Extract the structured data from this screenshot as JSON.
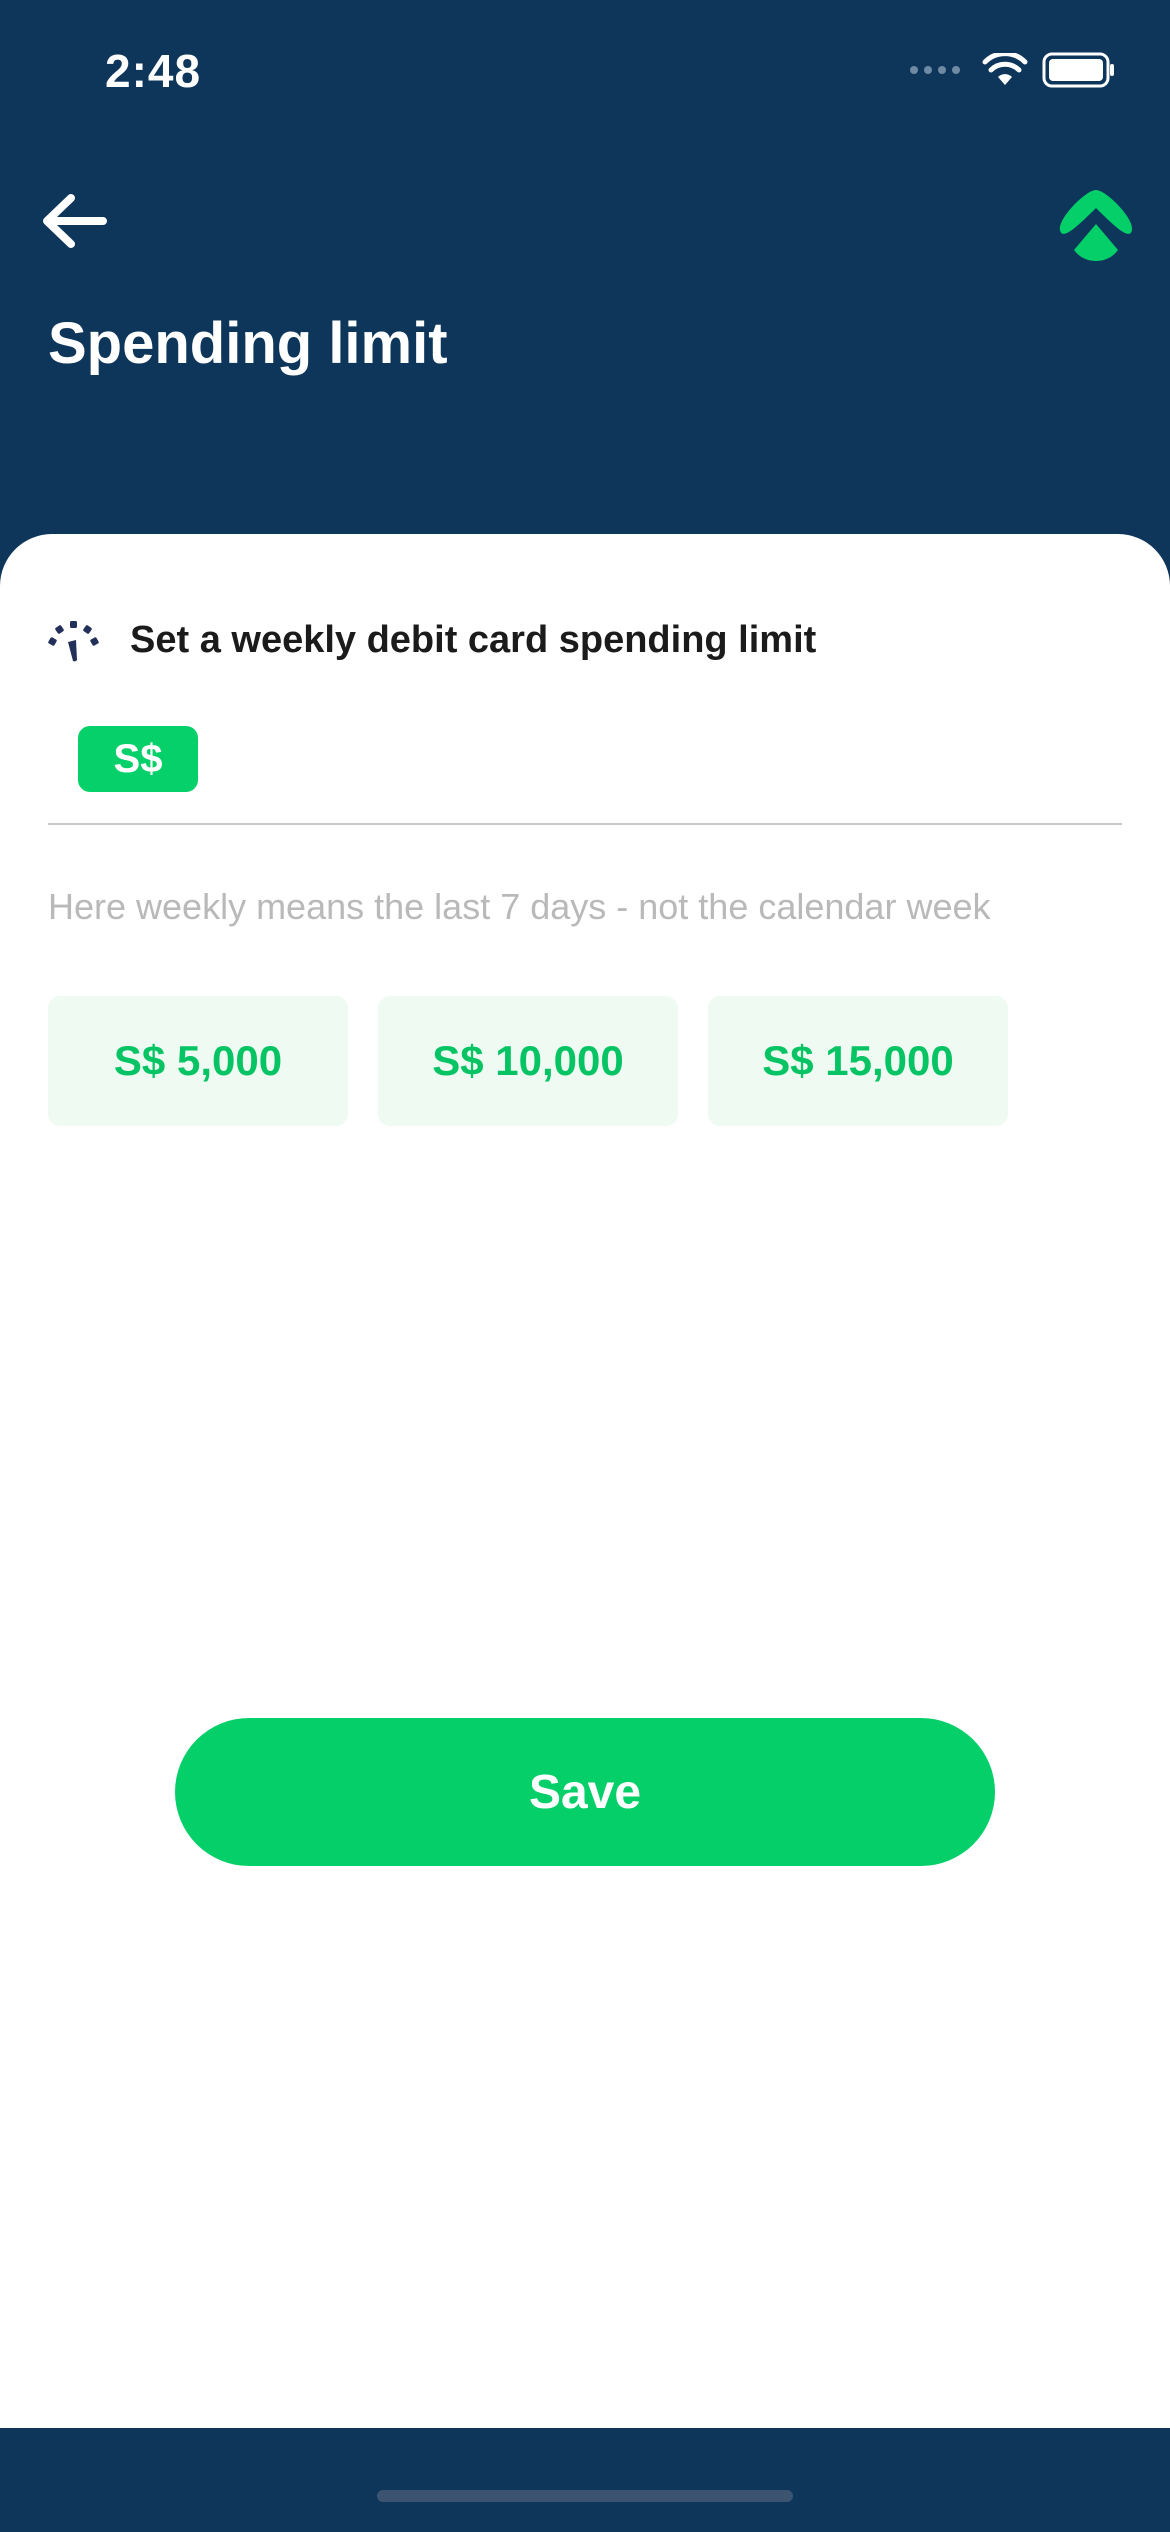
{
  "status_bar": {
    "time": "2:48"
  },
  "header": {
    "title": "Spending limit"
  },
  "section": {
    "title": "Set a weekly debit card spending limit"
  },
  "amount_field": {
    "currency": "S$",
    "value": "",
    "placeholder": ""
  },
  "helper_text": "Here weekly means the last 7 days - not the calendar week",
  "presets": [
    "S$ 5,000",
    "S$ 10,000",
    "S$ 15,000"
  ],
  "save_label": "Save",
  "colors": {
    "header_bg": "#0d365a",
    "accent_green": "#05cf69",
    "chip_bg": "#eefaf2",
    "helper_text": "#b9b9b9"
  },
  "icons": {
    "back": "arrow-left-icon",
    "brand": "brand-logo-icon",
    "section": "speedometer-icon",
    "wifi": "wifi-icon",
    "battery": "battery-icon",
    "signal": "cellular-signal-icon"
  }
}
